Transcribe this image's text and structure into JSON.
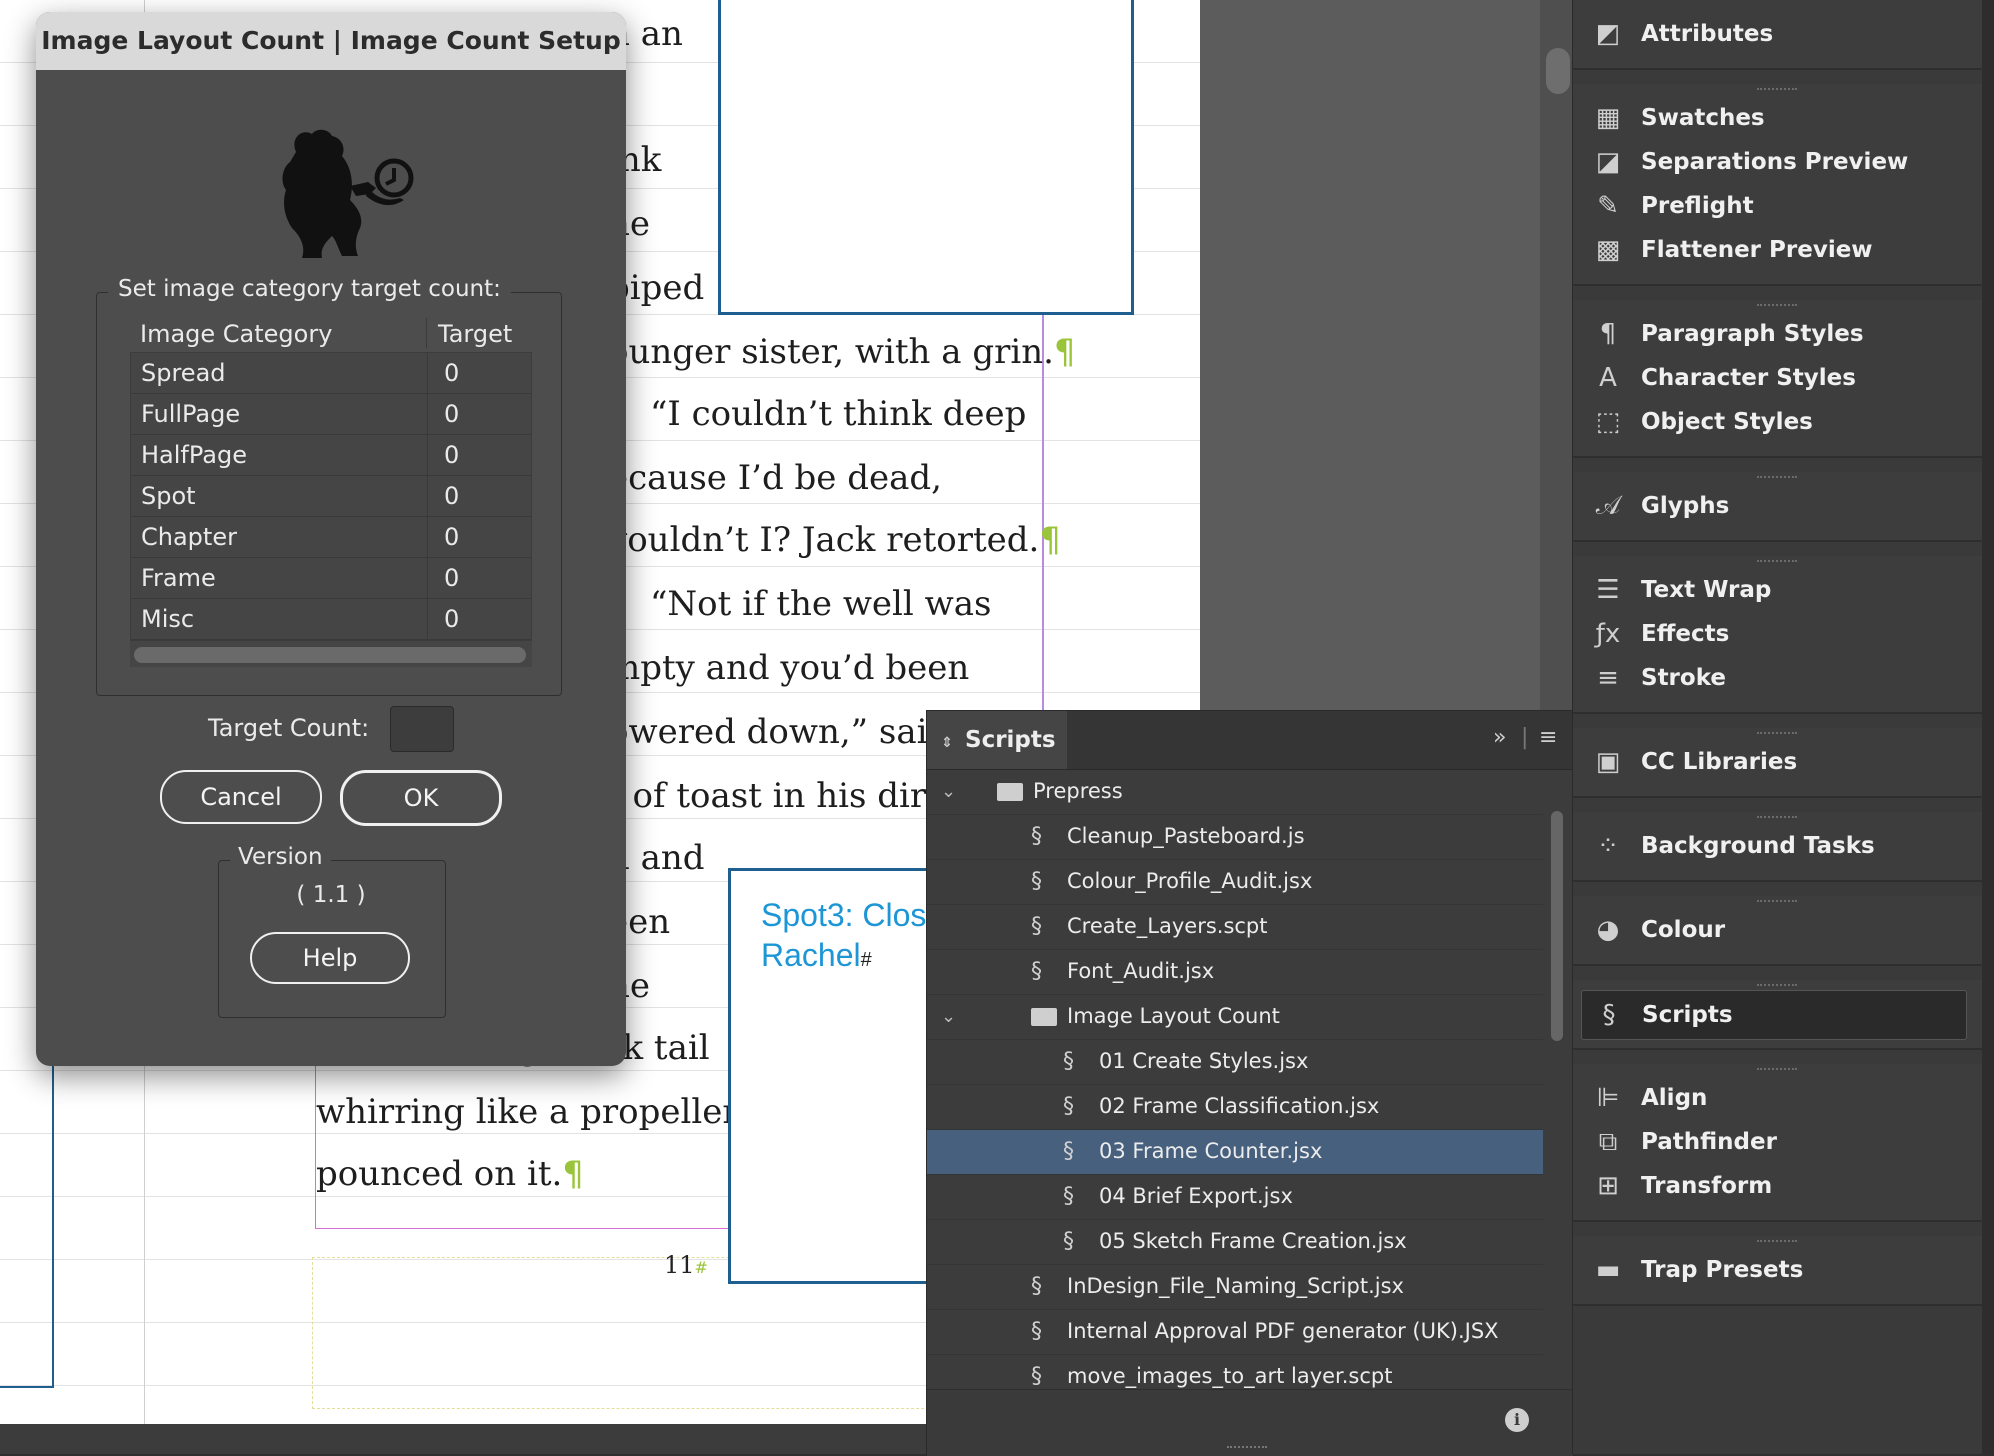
{
  "dialog": {
    "title": "Image Layout Count | Image Count Setup",
    "group_label": "Set image category target count:",
    "columns": [
      "Image Category",
      "Target"
    ],
    "rows": [
      {
        "category": "Spread",
        "target": "0"
      },
      {
        "category": "FullPage",
        "target": "0"
      },
      {
        "category": "HalfPage",
        "target": "0"
      },
      {
        "category": "Spot",
        "target": "0"
      },
      {
        "category": "Chapter",
        "target": "0"
      },
      {
        "category": "Frame",
        "target": "0"
      },
      {
        "category": "Misc",
        "target": "0"
      }
    ],
    "target_count_label": "Target Count:",
    "target_count_value": "",
    "cancel_label": "Cancel",
    "ok_label": "OK",
    "version_label": "Version",
    "version_value": "( 1.1 )",
    "help_label": "Help"
  },
  "document": {
    "lines": [
      "n an",
      "ink",
      "ne",
      "piped",
      "ounger sister, with a grin.",
      "“I couldn’t think deep",
      "ecause I’d be dead,",
      "vouldn’t I? Jack retorted.",
      "“Not if the well was",
      "mpty and you’d been",
      "owered down,” saic",
      "t of toast in his dir",
      "d and",
      "een",
      "ne",
      "table, his big black tail",
      "whirring like a propeller,",
      "pounced on it."
    ],
    "pilcrow": "¶",
    "spot_caption_line1": "Spot3: Clos",
    "spot_caption_line2": "Rachel",
    "spot_caption_hash": "#",
    "folio": "11",
    "folio_mark": "#"
  },
  "scripts_panel": {
    "tab_label": "Scripts",
    "items": [
      {
        "label": "Prepress",
        "kind": "folder",
        "level": 0,
        "expanded": true,
        "selected": false
      },
      {
        "label": "Cleanup_Pasteboard.js",
        "kind": "script",
        "level": 1,
        "selected": false
      },
      {
        "label": "Colour_Profile_Audit.jsx",
        "kind": "script",
        "level": 1,
        "selected": false
      },
      {
        "label": "Create_Layers.scpt",
        "kind": "applescript",
        "level": 1,
        "selected": false
      },
      {
        "label": "Font_Audit.jsx",
        "kind": "script",
        "level": 1,
        "selected": false
      },
      {
        "label": "Image Layout Count",
        "kind": "folder",
        "level": 1,
        "expanded": true,
        "selected": false
      },
      {
        "label": "01 Create Styles.jsx",
        "kind": "script",
        "level": 2,
        "selected": false
      },
      {
        "label": "02 Frame Classification.jsx",
        "kind": "script",
        "level": 2,
        "selected": false
      },
      {
        "label": "03 Frame Counter.jsx",
        "kind": "script",
        "level": 2,
        "selected": true
      },
      {
        "label": "04 Brief Export.jsx",
        "kind": "script",
        "level": 2,
        "selected": false
      },
      {
        "label": "05 Sketch Frame Creation.jsx",
        "kind": "script",
        "level": 2,
        "selected": false
      },
      {
        "label": "InDesign_File_Naming_Script.jsx",
        "kind": "script",
        "level": 1,
        "selected": false
      },
      {
        "label": "Internal Approval PDF generator (UK).JSX",
        "kind": "script",
        "level": 1,
        "selected": false
      },
      {
        "label": "move_images_to_art layer.scpt",
        "kind": "applescript",
        "level": 1,
        "selected": false
      }
    ]
  },
  "dock": {
    "groups": [
      {
        "items": [
          {
            "label": "Attributes",
            "icon": "attributes-icon",
            "active": false
          }
        ]
      },
      {
        "items": [
          {
            "label": "Swatches",
            "icon": "swatches-icon",
            "active": false
          },
          {
            "label": "Separations Preview",
            "icon": "separations-icon",
            "active": false
          },
          {
            "label": "Preflight",
            "icon": "preflight-icon",
            "active": false
          },
          {
            "label": "Flattener Preview",
            "icon": "flattener-icon",
            "active": false
          }
        ]
      },
      {
        "items": [
          {
            "label": "Paragraph Styles",
            "icon": "paragraph-styles-icon",
            "active": false
          },
          {
            "label": "Character Styles",
            "icon": "character-styles-icon",
            "active": false
          },
          {
            "label": "Object Styles",
            "icon": "object-styles-icon",
            "active": false
          }
        ]
      },
      {
        "items": [
          {
            "label": "Glyphs",
            "icon": "glyphs-icon",
            "active": false
          }
        ]
      },
      {
        "items": [
          {
            "label": "Text Wrap",
            "icon": "text-wrap-icon",
            "active": false
          },
          {
            "label": "Effects",
            "icon": "effects-icon",
            "active": false
          },
          {
            "label": "Stroke",
            "icon": "stroke-icon",
            "active": false
          }
        ]
      },
      {
        "items": [
          {
            "label": "CC Libraries",
            "icon": "cc-libraries-icon",
            "active": false
          }
        ]
      },
      {
        "items": [
          {
            "label": "Background Tasks",
            "icon": "background-tasks-icon",
            "active": false
          }
        ]
      },
      {
        "items": [
          {
            "label": "Colour",
            "icon": "colour-icon",
            "active": false
          }
        ]
      },
      {
        "items": [
          {
            "label": "Scripts",
            "icon": "scripts-icon",
            "active": true
          }
        ]
      },
      {
        "items": [
          {
            "label": "Align",
            "icon": "align-icon",
            "active": false
          },
          {
            "label": "Pathfinder",
            "icon": "pathfinder-icon",
            "active": false
          },
          {
            "label": "Transform",
            "icon": "transform-icon",
            "active": false
          }
        ]
      },
      {
        "items": [
          {
            "label": "Trap Presets",
            "icon": "trap-presets-icon",
            "active": false
          }
        ]
      }
    ]
  }
}
